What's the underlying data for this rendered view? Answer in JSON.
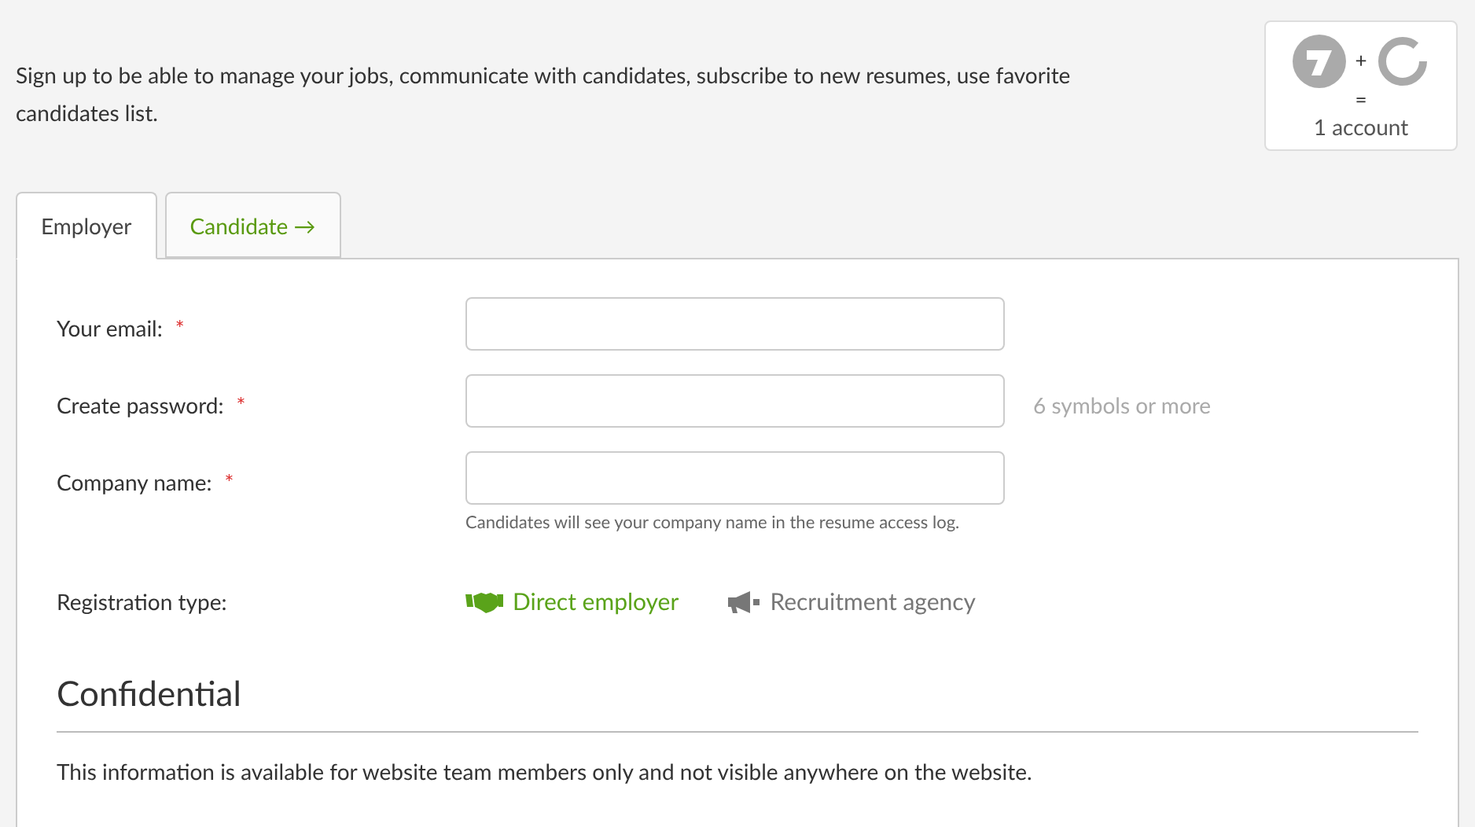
{
  "intro": "Sign up to be able to manage your jobs, communicate with candidates, subscribe to new resumes, use favorite candidates list.",
  "account_badge": {
    "plus": "+",
    "equals": "=",
    "caption": "1 account"
  },
  "tabs": [
    {
      "label": "Employer",
      "selected": true
    },
    {
      "label": "Candidate →",
      "selected": false
    }
  ],
  "fields": [
    {
      "label": "Your email:",
      "required_mark": "*"
    },
    {
      "label": "Create password:",
      "required_mark": "*",
      "hint": "6 symbols or more"
    },
    {
      "label": "Company name:",
      "required_mark": "*",
      "note": "Candidates will see your company name in the resume access log."
    }
  ],
  "registration_type": {
    "label": "Registration type:",
    "options": [
      {
        "label": "Direct employer",
        "selected": true,
        "kind": "handshake"
      },
      {
        "label": "Recruitment agency",
        "selected": false,
        "kind": "megaphone"
      }
    ]
  },
  "confidential": {
    "heading": "Confidential",
    "text": "This information is available for website team members only and not visible anywhere on the website."
  }
}
